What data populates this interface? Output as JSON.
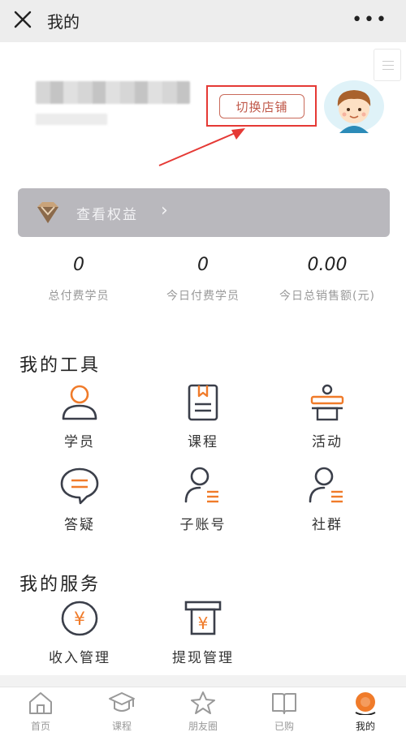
{
  "header": {
    "title": "我的",
    "close_icon": "close-icon",
    "more_label": "•••"
  },
  "profile": {
    "switch_store_label": "切换店铺"
  },
  "rights": {
    "label": "查看权益",
    "chevron": "›"
  },
  "stats": [
    {
      "value": "0",
      "caption": "总付费学员"
    },
    {
      "value": "0",
      "caption": "今日付费学员"
    },
    {
      "value": "0.00",
      "caption": "今日总销售额(元)"
    }
  ],
  "tools": {
    "title": "我的工具",
    "items": [
      {
        "label": "学员",
        "icon": "student-icon"
      },
      {
        "label": "课程",
        "icon": "course-icon"
      },
      {
        "label": "活动",
        "icon": "activity-icon"
      },
      {
        "label": "答疑",
        "icon": "qa-icon"
      },
      {
        "label": "子账号",
        "icon": "sub-account-icon"
      },
      {
        "label": "社群",
        "icon": "community-icon"
      }
    ]
  },
  "services": {
    "title": "我的服务",
    "items": [
      {
        "label": "收入管理",
        "icon": "income-icon"
      },
      {
        "label": "提现管理",
        "icon": "withdraw-icon"
      }
    ]
  },
  "tabbar": {
    "items": [
      {
        "label": "首页",
        "icon": "home-icon"
      },
      {
        "label": "课程",
        "icon": "course-tab-icon"
      },
      {
        "label": "朋友圈",
        "icon": "star-icon"
      },
      {
        "label": "已购",
        "icon": "book-icon"
      },
      {
        "label": "我的",
        "icon": "me-icon",
        "active": true
      }
    ]
  },
  "colors": {
    "accent": "#f07b2a",
    "icon_dark": "#3b3f4a",
    "annotation_red": "#e53935"
  }
}
